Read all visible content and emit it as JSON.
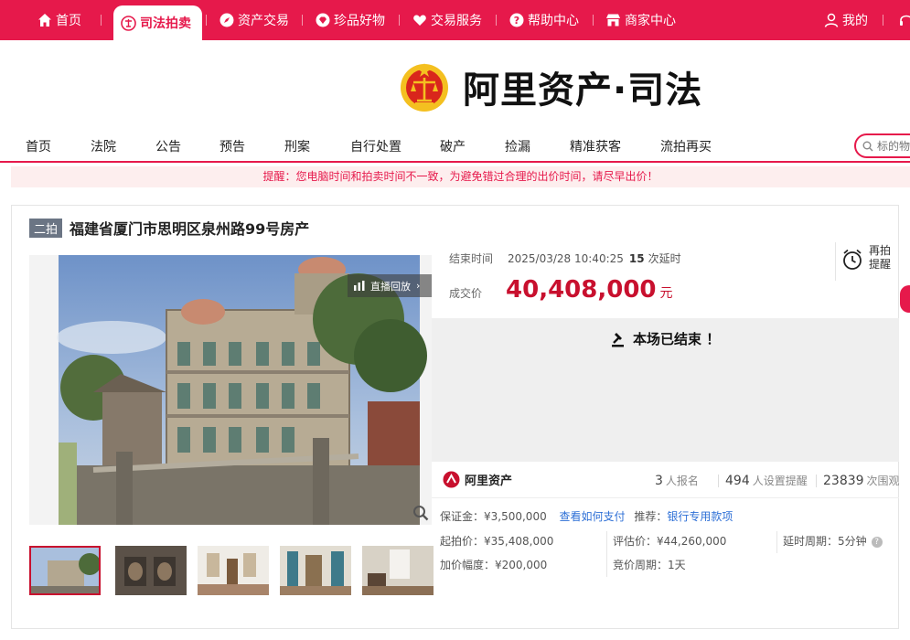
{
  "topbar": {
    "tabs": [
      {
        "label": "首页",
        "icon": "home-icon"
      },
      {
        "label": "司法拍卖",
        "icon": "court-emblem-icon",
        "active": true
      },
      {
        "label": "资产交易",
        "icon": "compass-icon"
      },
      {
        "label": "珍品好物",
        "icon": "diamond-icon"
      },
      {
        "label": "交易服务",
        "icon": "heart-icon"
      },
      {
        "label": "帮助中心",
        "icon": "question-icon"
      },
      {
        "label": "商家中心",
        "icon": "shop-icon"
      }
    ],
    "mine": "我的",
    "accent": "#e6194b"
  },
  "logo": {
    "brand": "阿里资产·司法"
  },
  "nav": {
    "items": [
      "首页",
      "法院",
      "公告",
      "预告",
      "刑案",
      "自行处置",
      "破产",
      "捡漏",
      "精准获客",
      "流拍再买"
    ],
    "search_placeholder": "标的物"
  },
  "notice": "提醒：您电脑时间和拍卖时间不一致，为避免错过合理的出价时间，请尽早出价！",
  "item": {
    "badge": "二拍",
    "title": "福建省厦门市思明区泉州路99号房产",
    "replay": "直播回放",
    "end_label": "结束时间",
    "end_time": "2025/03/28 10:40:25",
    "delay_count": "15",
    "delay_unit": "次延时",
    "remind": "再拍提醒",
    "deal_label": "成交价",
    "deal_price": "40,408,000",
    "deal_unit": "元",
    "ended_msg": "本场已结束 ！",
    "price_color": "#c8102e"
  },
  "stats": {
    "brand": "阿里资产",
    "signups": "3",
    "signups_unit": "人报名",
    "reminders": "494",
    "reminders_unit": "人设置提醒",
    "views": "23839",
    "views_unit": "次围观"
  },
  "details": {
    "deposit": "保证金：¥3,500,000",
    "deposit_link": "查看如何支付",
    "recommend_label": "推荐：",
    "recommend_link": "银行专用款项",
    "start_price": "起拍价：¥35,408,000",
    "assess_price": "评估价：¥44,260,000",
    "delay_cycle": "延时周期：5分钟",
    "increment": "加价幅度：¥200,000",
    "bid_cycle": "竞价周期：1天"
  }
}
